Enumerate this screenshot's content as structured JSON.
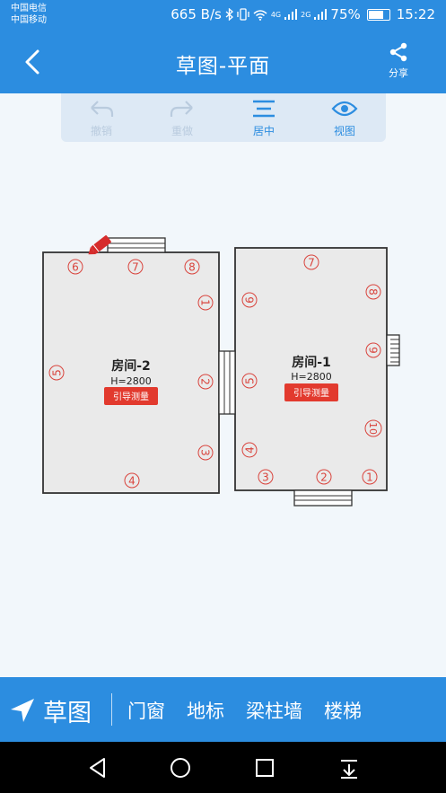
{
  "status_bar": {
    "carrier_1": "中国电信",
    "carrier_2": "中国移动",
    "speed": "665 B/s",
    "network_1": "4G",
    "network_2": "2G",
    "battery": "75%",
    "battery_level": 0.75,
    "time": "15:22"
  },
  "header": {
    "back_icon": "chevron-left-icon",
    "title": "草图-平面",
    "share_label": "分享",
    "share_icon": "share-icon"
  },
  "toolbar": {
    "undo_label": "撤销",
    "redo_label": "重做",
    "center_label": "居中",
    "view_label": "视图"
  },
  "floorplan": {
    "room_1": {
      "name": "房间-1",
      "height": "H=2800",
      "button": "引导测量",
      "markers": [
        "1",
        "2",
        "3",
        "4",
        "5",
        "6",
        "7",
        "8",
        "9",
        "10"
      ]
    },
    "room_2": {
      "name": "房间-2",
      "height": "H=2800",
      "button": "引导测量",
      "markers": [
        "1",
        "2",
        "3",
        "4",
        "5",
        "6",
        "7",
        "8"
      ]
    },
    "colors": {
      "wall": "#333333",
      "room_fill": "#eaeaea",
      "marker": "#d9443d",
      "button": "#e23a2e"
    }
  },
  "bottom_bar": {
    "nav_icon": "navigation-arrow-icon",
    "sketch_label": "草图",
    "items": [
      "门窗",
      "地标",
      "梁柱墙",
      "楼梯"
    ]
  }
}
